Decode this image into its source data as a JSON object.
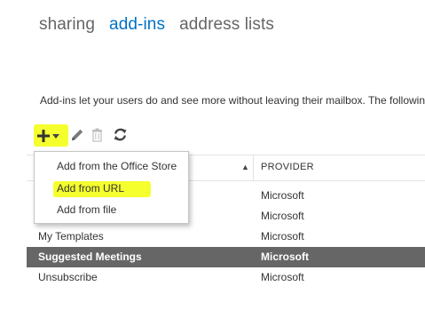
{
  "tabs": [
    {
      "label": "sharing",
      "active": false
    },
    {
      "label": "add-ins",
      "active": true
    },
    {
      "label": "address lists",
      "active": false
    }
  ],
  "description": "Add-ins let your users do and see more without leaving their mailbox. The followin",
  "toolbar": {
    "add_icon": "plus-icon",
    "add_menu_icon": "caret-down-icon",
    "edit_icon": "pencil-icon",
    "delete_icon": "trash-icon",
    "refresh_icon": "refresh-icon"
  },
  "add_menu": {
    "items": [
      "Add from the Office Store",
      "Add from URL",
      "Add from file"
    ],
    "highlighted_item": "Add from URL"
  },
  "table": {
    "sort_indicator": "▲",
    "columns": {
      "provider": "PROVIDER"
    },
    "rows": [
      {
        "name": "",
        "provider": "Microsoft",
        "selected": false
      },
      {
        "name": "",
        "provider": "Microsoft",
        "selected": false
      },
      {
        "name": "My Templates",
        "provider": "Microsoft",
        "selected": false
      },
      {
        "name": "Suggested Meetings",
        "provider": "Microsoft",
        "selected": true
      },
      {
        "name": "Unsubscribe",
        "provider": "Microsoft",
        "selected": false
      }
    ]
  },
  "colors": {
    "accent": "#0072c6",
    "highlight": "#f5ff2e",
    "selected_row": "#666666"
  }
}
